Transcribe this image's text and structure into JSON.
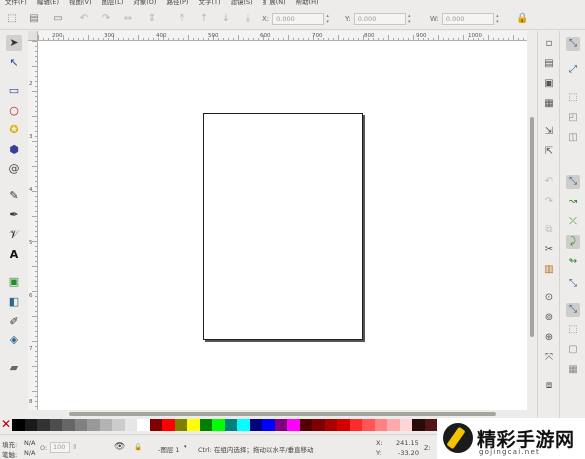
{
  "menu": [
    "文件(F)",
    "编辑(E)",
    "视图(V)",
    "图层(L)",
    "对象(O)",
    "路径(P)",
    "文字(T)",
    "滤镜(S)",
    "扩展(N)",
    "帮助(H)"
  ],
  "toolbar": {
    "x_label": "X:",
    "x_value": "0.000",
    "y_label": "Y:",
    "y_value": "0.000",
    "w_label": "W:",
    "w_value": "0.000"
  },
  "ruler": {
    "h_ticks": [
      "200",
      "300",
      "400",
      "500",
      "600",
      "700",
      "800",
      "900",
      "1000"
    ],
    "v_ticks": [
      "2",
      "3",
      "4",
      "5",
      "6",
      "7",
      "8"
    ]
  },
  "palette": {
    "colors": [
      "#000000",
      "#1a1a1a",
      "#333333",
      "#4d4d4d",
      "#666666",
      "#808080",
      "#999999",
      "#b3b3b3",
      "#cccccc",
      "#e6e6e6",
      "#ffffff",
      "#800000",
      "#ff0000",
      "#808000",
      "#ffff00",
      "#008000",
      "#00ff00",
      "#008080",
      "#00ffff",
      "#000080",
      "#0000ff",
      "#800080",
      "#ff00ff",
      "#550000",
      "#800000",
      "#aa0000",
      "#d40000",
      "#ff2a2a",
      "#ff5555",
      "#ff8080",
      "#ffaaaa",
      "#ffd5d5",
      "#280b0b",
      "#501616"
    ]
  },
  "status": {
    "fill_label": "填充:",
    "fill_value": "N/A",
    "stroke_label": "笔触:",
    "stroke_value": "N/A",
    "opacity_value": "100",
    "layer_value": "-图层 1",
    "message": "Ctrl: 在组内选择；拖动以水平/垂直移动",
    "x_label": "X:",
    "x_value": "241.15",
    "y_label": "Y:",
    "y_value": "-33.20",
    "z_label": "Z:"
  },
  "watermark": {
    "title": "精彩手游网",
    "url": "gojingcai.net"
  }
}
